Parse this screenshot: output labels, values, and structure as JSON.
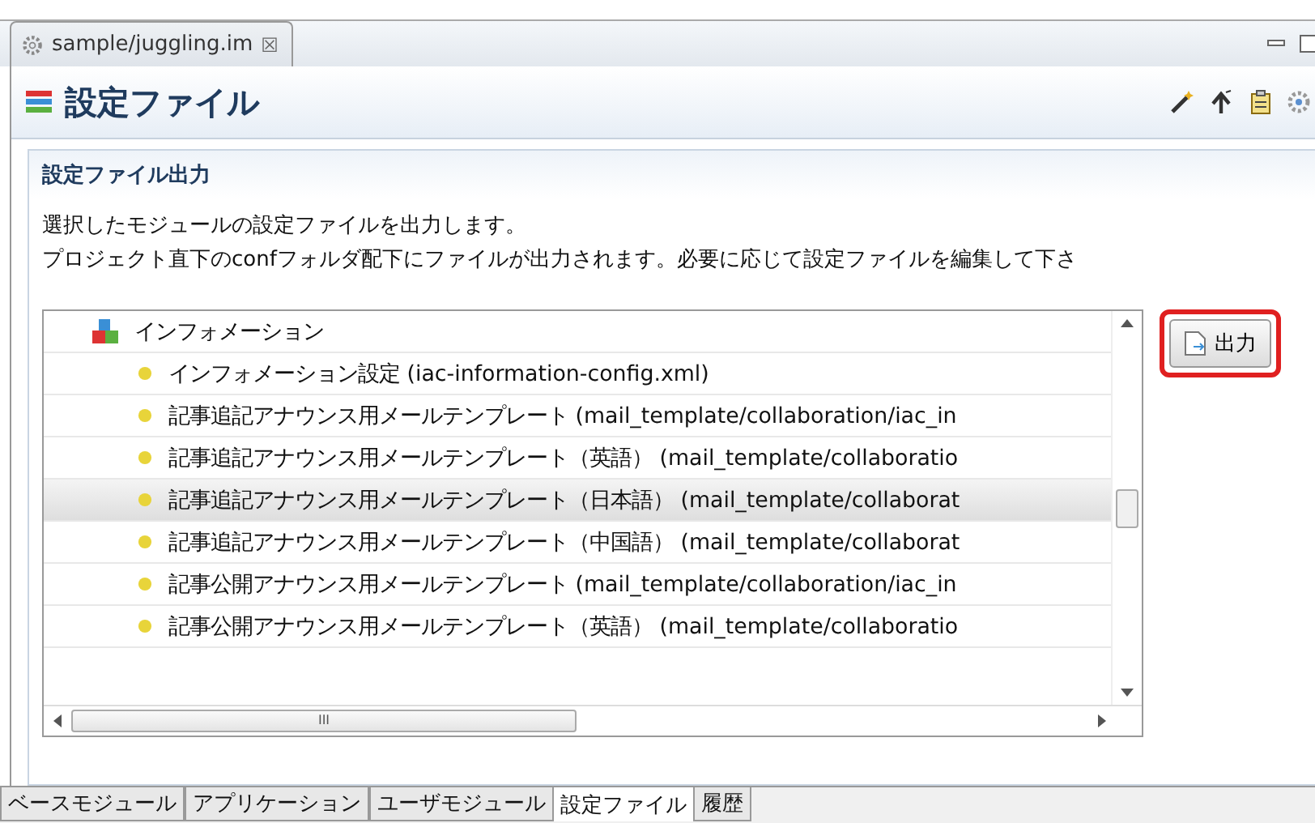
{
  "editor_tab": {
    "title": "sample/juggling.im",
    "close": "☒"
  },
  "header": {
    "title": "設定ファイル"
  },
  "section": {
    "title": "設定ファイル出力",
    "description": [
      "選択したモジュールの設定ファイルを出力します。",
      "プロジェクト直下のconfフォルダ配下にファイルが出力されます。必要に応じて設定ファイルを編集して下さ"
    ]
  },
  "tree": {
    "group": "インフォメーション",
    "items": [
      {
        "label": "インフォメーション設定 (iac-information-config.xml)",
        "selected": false
      },
      {
        "label": "記事追記アナウンス用メールテンプレート (mail_template/collaboration/iac_in",
        "selected": false
      },
      {
        "label": "記事追記アナウンス用メールテンプレート（英語） (mail_template/collaboratio",
        "selected": false
      },
      {
        "label": "記事追記アナウンス用メールテンプレート（日本語） (mail_template/collaborat",
        "selected": true
      },
      {
        "label": "記事追記アナウンス用メールテンプレート（中国語） (mail_template/collaborat",
        "selected": false
      },
      {
        "label": "記事公開アナウンス用メールテンプレート (mail_template/collaboration/iac_in",
        "selected": false
      },
      {
        "label": "記事公開アナウンス用メールテンプレート（英語） (mail_template/collaboratio",
        "selected": false
      }
    ],
    "scroll_thumb": "III"
  },
  "output_button": {
    "label": "出力",
    "highlighted": true
  },
  "bottom_tabs": [
    {
      "label": "ベースモジュール",
      "selected": false
    },
    {
      "label": "アプリケーション",
      "selected": false
    },
    {
      "label": "ユーザモジュール",
      "selected": false
    },
    {
      "label": "設定ファイル",
      "selected": true
    },
    {
      "label": "履歴",
      "selected": false
    }
  ]
}
